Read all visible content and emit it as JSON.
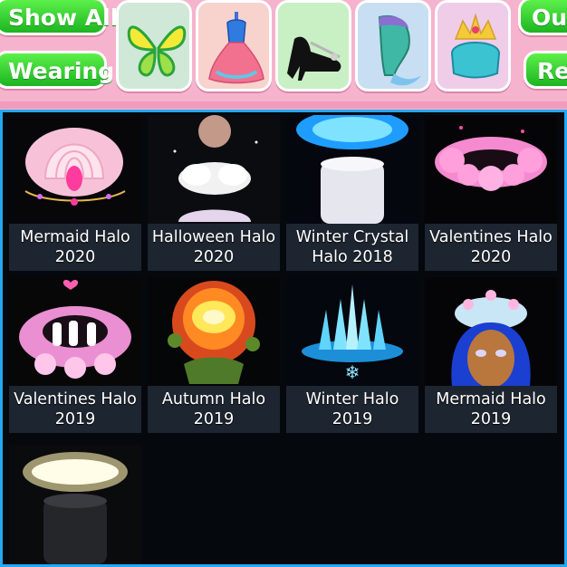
{
  "toolbar": {
    "show_all_label": "Show All",
    "wearing_label": "Wearing",
    "outfits_label": "Out",
    "reset_label": "Re"
  },
  "categories": [
    {
      "name": "wings",
      "icon": "wings-icon",
      "bg": "#cfe8d8"
    },
    {
      "name": "dresses",
      "icon": "dress-icon",
      "bg": "#f8d2cd"
    },
    {
      "name": "shoes",
      "icon": "heels-icon",
      "bg": "#c9efc5"
    },
    {
      "name": "tails",
      "icon": "mermaid-tail-icon",
      "bg": "#c8def2"
    },
    {
      "name": "accessories",
      "icon": "crown-icon",
      "bg": "#efcde8"
    }
  ],
  "items": [
    {
      "label": "Mermaid Halo\n2020",
      "icon": "mermaid-halo-2020-icon"
    },
    {
      "label": "Halloween Halo\n2020",
      "icon": "halloween-halo-2020-icon"
    },
    {
      "label": "Winter Crystal\nHalo 2018",
      "icon": "winter-crystal-halo-icon"
    },
    {
      "label": "Valentines Halo\n2020",
      "icon": "valentines-halo-2020-icon"
    },
    {
      "label": "Valentines Halo\n2019",
      "icon": "valentines-halo-2019-icon"
    },
    {
      "label": "Autumn Halo\n2019",
      "icon": "autumn-halo-icon"
    },
    {
      "label": "Winter Halo\n2019",
      "icon": "winter-halo-icon"
    },
    {
      "label": "Mermaid Halo\n2019",
      "icon": "mermaid-halo-2019-icon"
    },
    {
      "label": "",
      "icon": "glowing-halo-icon"
    }
  ],
  "colors": {
    "accent_blue": "#24a8f2",
    "button_green": "#2cc72b",
    "bar_pink": "#f6b3cd"
  }
}
